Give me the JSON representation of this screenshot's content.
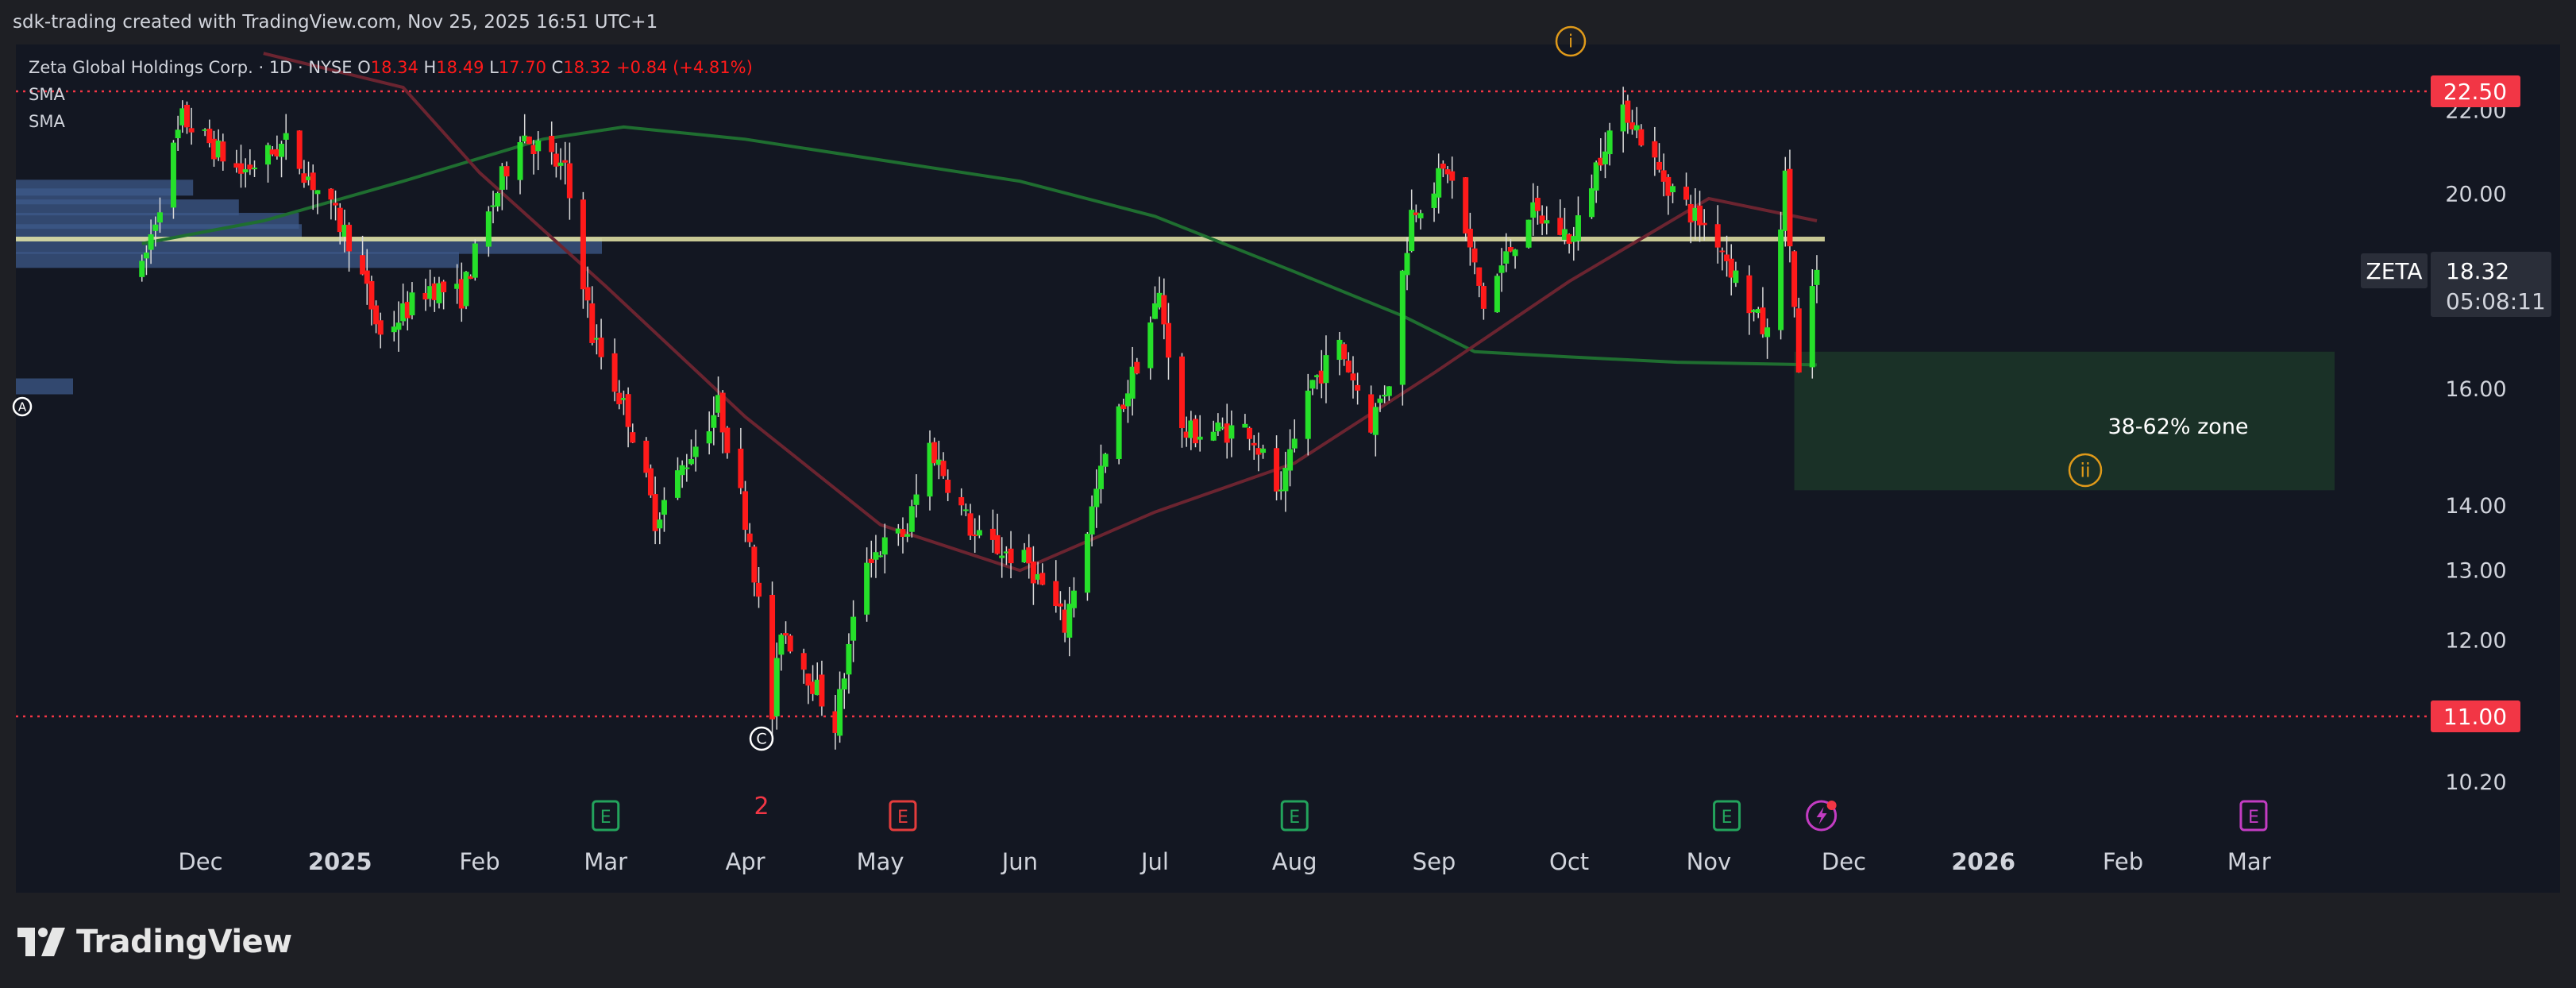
{
  "header": {
    "attribution": "sdk-trading created with TradingView.com, Nov 25, 2025 16:51 UTC+1"
  },
  "legend": {
    "symbol_name": "Zeta Global Holdings Corp. · 1D · NYSE",
    "o_label": "O",
    "o_value": "18.34",
    "h_label": "H",
    "h_value": "18.49",
    "l_label": "L",
    "l_value": "17.70",
    "c_label": "C",
    "c_value": "18.32",
    "change": "+0.84 (+4.81%)",
    "indicator_1": "SMA",
    "indicator_2": "SMA"
  },
  "ticker": {
    "symbol": "ZETA",
    "price": "18.32",
    "countdown": "05:08:11"
  },
  "zone": {
    "label": "38-62% zone",
    "wave_label": "ii"
  },
  "markers": {
    "wave_top": "i",
    "wave_a": "A",
    "wave_c": "C",
    "event_count": "2",
    "earnings_letter": "E"
  },
  "colors": {
    "background": "#131722",
    "outer": "#1e1f24",
    "up": "#26e02a",
    "down": "#ff1a1a",
    "sma_green": "#1f6e30",
    "sma_red": "#6b2430",
    "resistance": "#f23645",
    "zone_fill": "#1a3328",
    "volume_profile": "#3d5a8a",
    "level_yellow": "#e8e8a8",
    "wave_orange": "#e09a1a",
    "earnings_green": "#23a35c",
    "earnings_red": "#e33c3c",
    "dividends_purple": "#c33cc3"
  },
  "brand": {
    "name": "TradingView"
  },
  "chart_data": {
    "type": "candlestick",
    "title": "Zeta Global Holdings Corp. · 1D · NYSE",
    "y_axis_ticks": [
      22.0,
      20.0,
      16.0,
      14.0,
      13.0,
      12.0,
      10.2
    ],
    "y_axis_scale": "log",
    "x_axis_labels": [
      "Dec",
      "2025",
      "Feb",
      "Mar",
      "Apr",
      "May",
      "Jun",
      "Jul",
      "Aug",
      "Sep",
      "Oct",
      "Nov",
      "Dec",
      "2026",
      "Feb",
      "Mar"
    ],
    "horizontal_levels": [
      {
        "value": 22.5,
        "label": "22.50",
        "style": "dotted",
        "color": "#f23645"
      },
      {
        "value": 11.0,
        "label": "11.00",
        "style": "dotted",
        "color": "#f23645"
      },
      {
        "value": 19.0,
        "label": "",
        "style": "solid",
        "color": "#e8e8a8"
      }
    ],
    "last_price": 18.32,
    "zone": {
      "from_date": "2025-11-20",
      "to_date": "2026-03-20",
      "y_top": 16.7,
      "y_bottom": 14.25,
      "label": "38-62% zone"
    },
    "ohlc_path": [
      {
        "date": "2024-11-18",
        "price": 18.3
      },
      {
        "date": "2024-11-27",
        "price": 21.8
      },
      {
        "date": "2024-12-10",
        "price": 20.5
      },
      {
        "date": "2024-12-20",
        "price": 21.2
      },
      {
        "date": "2025-01-03",
        "price": 19.0
      },
      {
        "date": "2025-01-10",
        "price": 17.0
      },
      {
        "date": "2025-01-21",
        "price": 18.0
      },
      {
        "date": "2025-01-28",
        "price": 17.8
      },
      {
        "date": "2025-02-10",
        "price": 21.5
      },
      {
        "date": "2025-02-20",
        "price": 20.5
      },
      {
        "date": "2025-02-26",
        "price": 17.0
      },
      {
        "date": "2025-03-06",
        "price": 15.5
      },
      {
        "date": "2025-03-12",
        "price": 13.8
      },
      {
        "date": "2025-03-26",
        "price": 15.7
      },
      {
        "date": "2025-04-02",
        "price": 13.5
      },
      {
        "date": "2025-04-07",
        "price": 11.0
      },
      {
        "date": "2025-04-09",
        "price": 12.2
      },
      {
        "date": "2025-04-21",
        "price": 10.9
      },
      {
        "date": "2025-04-28",
        "price": 13.2
      },
      {
        "date": "2025-05-07",
        "price": 13.6
      },
      {
        "date": "2025-05-12",
        "price": 15.0
      },
      {
        "date": "2025-05-22",
        "price": 13.5
      },
      {
        "date": "2025-06-03",
        "price": 13.1
      },
      {
        "date": "2025-06-11",
        "price": 12.2
      },
      {
        "date": "2025-06-20",
        "price": 14.8
      },
      {
        "date": "2025-06-27",
        "price": 16.5
      },
      {
        "date": "2025-07-02",
        "price": 17.8
      },
      {
        "date": "2025-07-07",
        "price": 15.2
      },
      {
        "date": "2025-07-22",
        "price": 15.3
      },
      {
        "date": "2025-07-29",
        "price": 14.1
      },
      {
        "date": "2025-08-04",
        "price": 16.0
      },
      {
        "date": "2025-08-11",
        "price": 16.8
      },
      {
        "date": "2025-08-18",
        "price": 15.4
      },
      {
        "date": "2025-08-22",
        "price": 16.2
      },
      {
        "date": "2025-08-27",
        "price": 19.6
      },
      {
        "date": "2025-09-04",
        "price": 20.6
      },
      {
        "date": "2025-09-12",
        "price": 17.6
      },
      {
        "date": "2025-09-22",
        "price": 19.6
      },
      {
        "date": "2025-10-02",
        "price": 19.0
      },
      {
        "date": "2025-10-09",
        "price": 21.3
      },
      {
        "date": "2025-10-14",
        "price": 22.0
      },
      {
        "date": "2025-10-21",
        "price": 20.5
      },
      {
        "date": "2025-10-28",
        "price": 19.6
      },
      {
        "date": "2025-11-03",
        "price": 19.0
      },
      {
        "date": "2025-11-10",
        "price": 17.6
      },
      {
        "date": "2025-11-14",
        "price": 17.0
      },
      {
        "date": "2025-11-18",
        "price": 20.3
      },
      {
        "date": "2025-11-21",
        "price": 16.2
      },
      {
        "date": "2025-11-25",
        "price": 18.32
      }
    ],
    "sma_series": [
      {
        "name": "SMA",
        "color": "#1f6e30",
        "points": [
          {
            "date": "2024-11-18",
            "price": 18.9
          },
          {
            "date": "2024-12-15",
            "price": 19.4
          },
          {
            "date": "2025-01-15",
            "price": 20.3
          },
          {
            "date": "2025-02-15",
            "price": 21.3
          },
          {
            "date": "2025-03-05",
            "price": 21.6
          },
          {
            "date": "2025-04-01",
            "price": 21.3
          },
          {
            "date": "2025-05-01",
            "price": 20.8
          },
          {
            "date": "2025-06-01",
            "price": 20.3
          },
          {
            "date": "2025-07-01",
            "price": 19.5
          },
          {
            "date": "2025-08-01",
            "price": 18.3
          },
          {
            "date": "2025-08-25",
            "price": 17.4
          },
          {
            "date": "2025-09-10",
            "price": 16.7
          },
          {
            "date": "2025-10-01",
            "price": 16.6
          },
          {
            "date": "2025-10-25",
            "price": 16.5
          },
          {
            "date": "2025-11-25",
            "price": 16.45
          }
        ]
      },
      {
        "name": "SMA",
        "color": "#6b2430",
        "points": [
          {
            "date": "2024-12-15",
            "price": 23.5
          },
          {
            "date": "2025-01-15",
            "price": 22.6
          },
          {
            "date": "2025-02-01",
            "price": 20.5
          },
          {
            "date": "2025-03-01",
            "price": 18.0
          },
          {
            "date": "2025-04-01",
            "price": 15.5
          },
          {
            "date": "2025-05-01",
            "price": 13.7
          },
          {
            "date": "2025-06-01",
            "price": 13.0
          },
          {
            "date": "2025-07-01",
            "price": 13.9
          },
          {
            "date": "2025-08-01",
            "price": 14.7
          },
          {
            "date": "2025-09-01",
            "price": 16.3
          },
          {
            "date": "2025-10-01",
            "price": 18.1
          },
          {
            "date": "2025-11-01",
            "price": 19.9
          },
          {
            "date": "2025-11-25",
            "price": 19.4
          }
        ]
      }
    ],
    "volume_profile_bars": [
      {
        "price": 20.15,
        "length": 0.62
      },
      {
        "price": 19.95,
        "length": 0.55
      },
      {
        "price": 19.7,
        "length": 0.78
      },
      {
        "price": 19.4,
        "length": 0.99
      },
      {
        "price": 19.15,
        "length": 1.0
      },
      {
        "price": 18.85,
        "length": 2.05
      },
      {
        "price": 18.55,
        "length": 1.55
      },
      {
        "price": 16.05,
        "length": 0.2
      }
    ],
    "events": [
      {
        "date": "2025-03-01",
        "type": "earnings",
        "color": "#23a35c"
      },
      {
        "date": "2025-05-06",
        "type": "earnings",
        "color": "#e33c3c"
      },
      {
        "date": "2025-08-01",
        "type": "earnings",
        "color": "#23a35c"
      },
      {
        "date": "2025-11-05",
        "type": "earnings",
        "color": "#23a35c"
      },
      {
        "date": "2025-11-26",
        "type": "upcoming",
        "color": "#c33cc3"
      },
      {
        "date": "2026-03-02",
        "type": "earnings",
        "color": "#c33cc3"
      }
    ]
  }
}
